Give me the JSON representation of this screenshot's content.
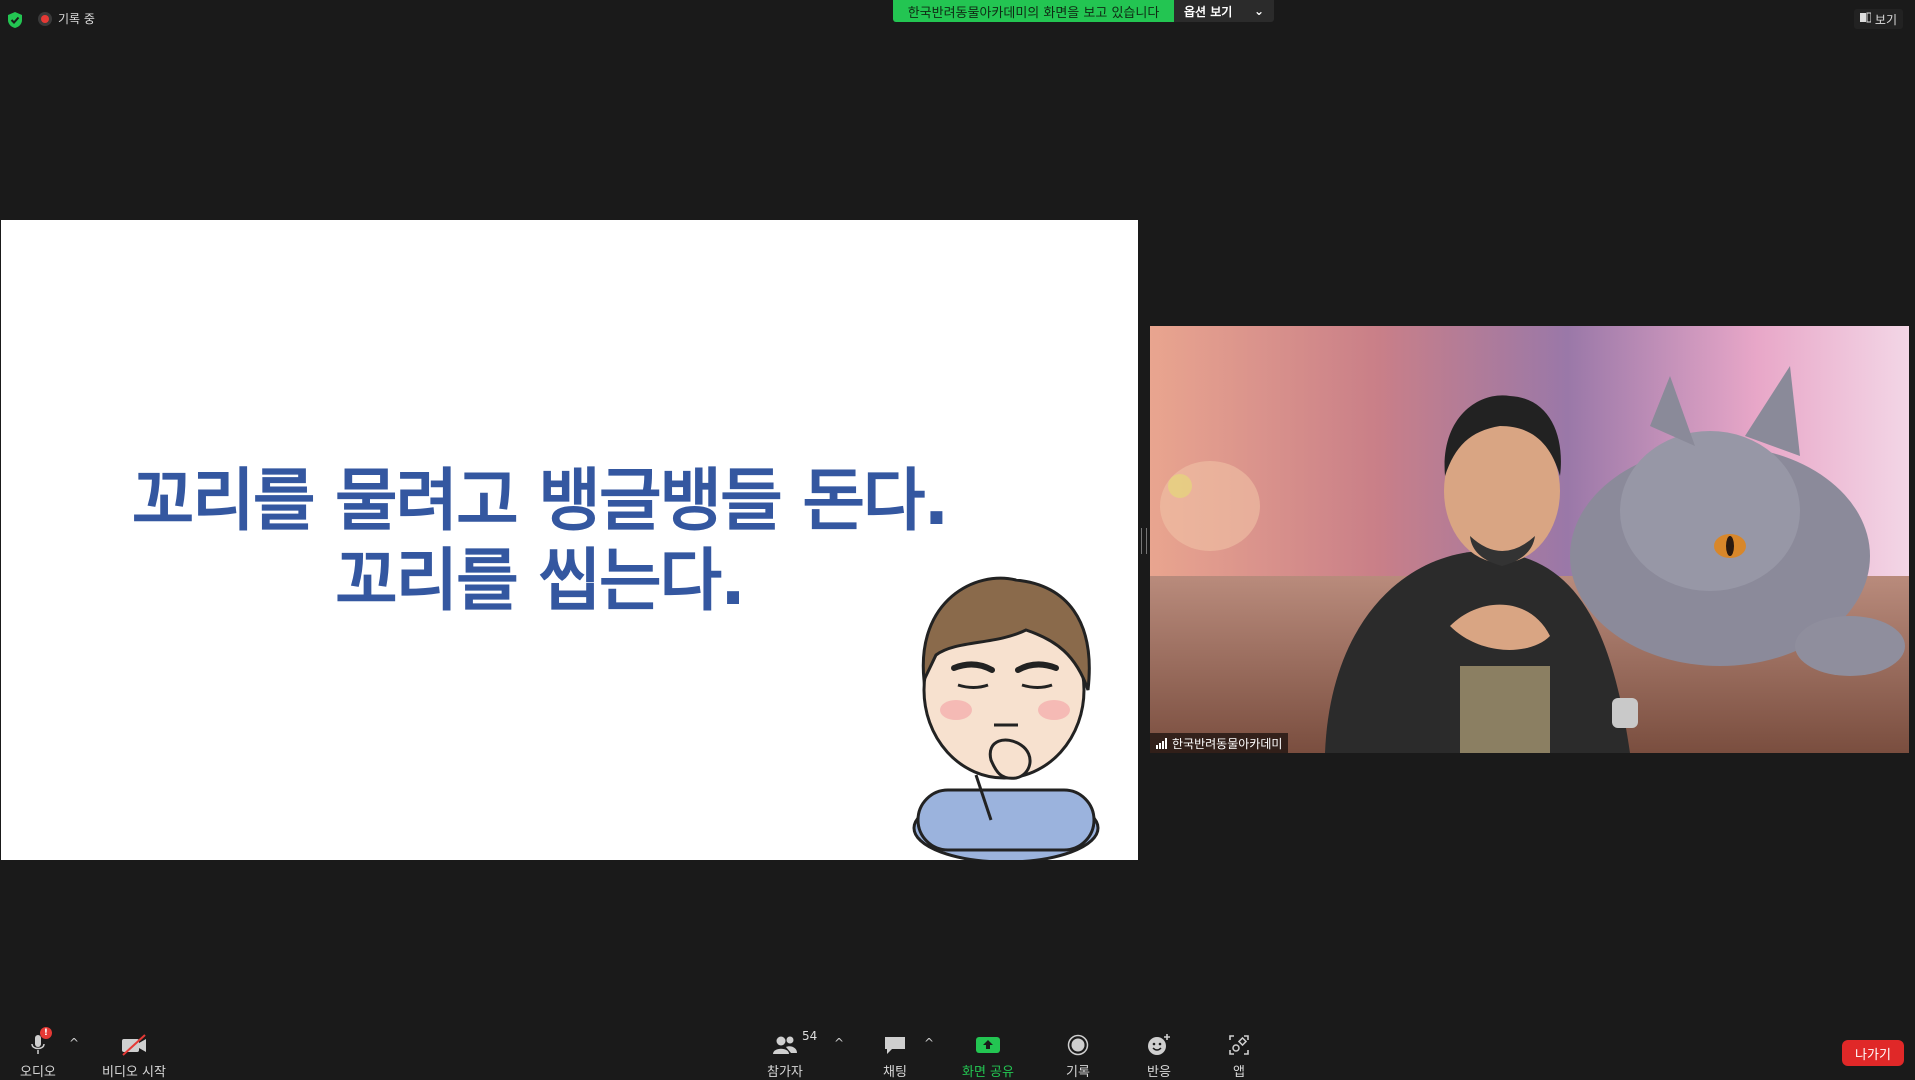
{
  "top_bar": {
    "recording_label": "기록 중",
    "share_banner": "한국반려동물아카데미의 화면을 보고 있습니다",
    "view_options_label": "옵션 보기",
    "view_label": "보기"
  },
  "slide": {
    "line1": "꼬리를 물려고 뱅글뱅들 돈다.",
    "line2": "꼬리를 씹는다."
  },
  "video": {
    "participant_name": "한국반려동물아카데미"
  },
  "toolbar": {
    "audio_label": "오디오",
    "audio_badge": "!",
    "video_label": "비디오 시작",
    "participants_label": "참가자",
    "participants_count": "54",
    "chat_label": "채팅",
    "share_label": "화면 공유",
    "record_label": "기록",
    "reactions_label": "반응",
    "apps_label": "앱",
    "leave_label": "나가기"
  },
  "colors": {
    "accent_green": "#23c552",
    "leave_red": "#e02828",
    "slide_text": "#3457a0"
  },
  "icons": [
    "shield-check-icon",
    "recording-icon",
    "chevron-down-icon",
    "view-icon",
    "microphone-icon",
    "video-off-icon",
    "participants-icon",
    "chat-icon",
    "share-screen-icon",
    "record-icon",
    "reaction-icon",
    "apps-icon",
    "signal-icon"
  ]
}
